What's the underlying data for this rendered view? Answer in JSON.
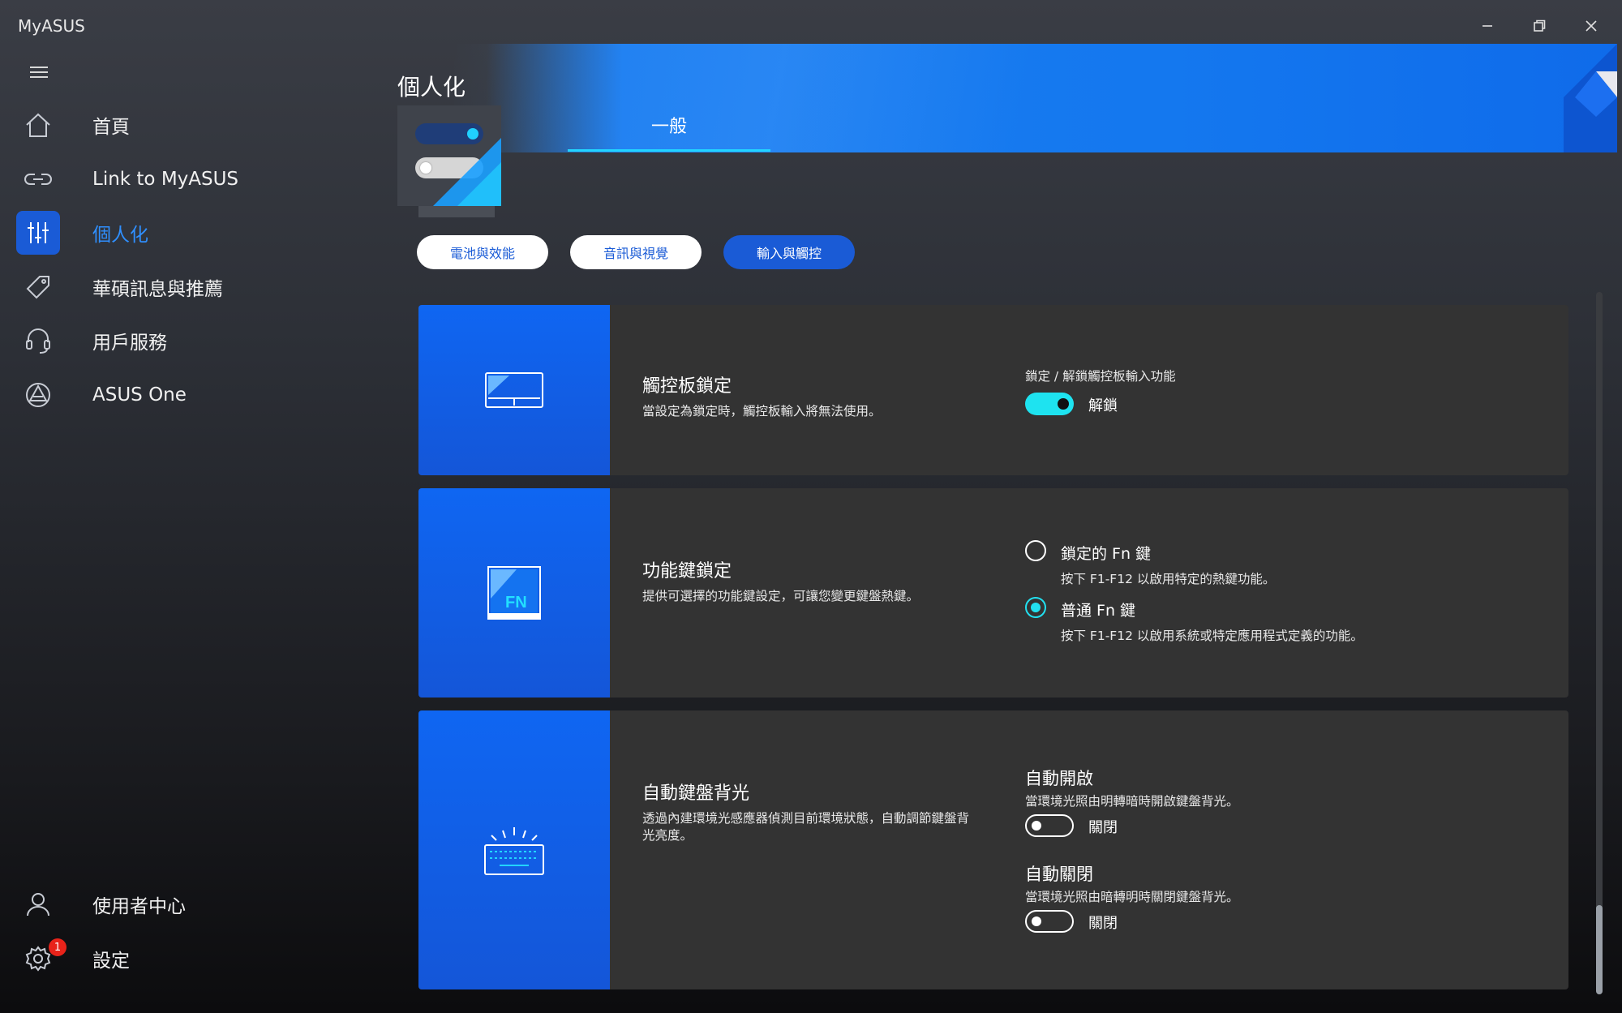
{
  "app": {
    "title": "MyASUS"
  },
  "window_controls": {
    "minimize": "minimize-icon",
    "restore": "restore-icon",
    "close": "close-icon"
  },
  "sidebar": {
    "items": [
      {
        "label": "首頁",
        "icon": "home-icon"
      },
      {
        "label": "Link to MyASUS",
        "icon": "link-icon"
      },
      {
        "label": "個人化",
        "icon": "sliders-icon",
        "active": true
      },
      {
        "label": "華碩訊息與推薦",
        "icon": "tag-icon"
      },
      {
        "label": "用戶服務",
        "icon": "headset-icon"
      },
      {
        "label": "ASUS One",
        "icon": "asus-one-icon"
      }
    ],
    "bottom": [
      {
        "label": "使用者中心",
        "icon": "user-icon"
      },
      {
        "label": "設定",
        "icon": "gear-icon",
        "badge": "1"
      }
    ]
  },
  "header": {
    "title": "個人化",
    "tabs": [
      {
        "label": "一般",
        "active": true
      }
    ]
  },
  "categories": [
    {
      "label": "電池與效能",
      "active": false
    },
    {
      "label": "音訊與視覺",
      "active": false
    },
    {
      "label": "輸入與觸控",
      "active": true
    }
  ],
  "cards": {
    "touchpad": {
      "icon": "touchpad-icon",
      "title": "觸控板鎖定",
      "description": "當設定為鎖定時，觸控板輸入將無法使用。",
      "option_label": "鎖定 / 解鎖觸控板輸入功能",
      "toggle_on": true,
      "toggle_text": "解鎖"
    },
    "fn_lock": {
      "icon": "fn-key-icon",
      "title": "功能鍵鎖定",
      "description": "提供可選擇的功能鍵設定，可讓您變更鍵盤熱鍵。",
      "options": [
        {
          "label": "鎖定的 Fn 鍵",
          "desc": "按下 F1-F12 以啟用特定的熱鍵功能。",
          "checked": false
        },
        {
          "label": "普通 Fn 鍵",
          "desc": "按下 F1-F12 以啟用系統或特定應用程式定義的功能。",
          "checked": true
        }
      ]
    },
    "backlight": {
      "icon": "keyboard-backlight-icon",
      "title": "自動鍵盤背光",
      "description_line1": "透過內建環境光感應器偵測目前環境狀態，自動調節鍵盤背",
      "description_line2": "光亮度。",
      "auto_on": {
        "title": "自動開啟",
        "desc": "當環境光照由明轉暗時開啟鍵盤背光。",
        "toggle_text": "關閉",
        "toggle_on": false
      },
      "auto_off": {
        "title": "自動關閉",
        "desc": "當環境光照由暗轉明時關閉鍵盤背光。",
        "toggle_text": "關閉",
        "toggle_on": false
      }
    }
  },
  "colors": {
    "accent": "#1a5bd6",
    "highlight": "#22e0f0",
    "card_bg": "#333333",
    "banner": "#1478ef"
  }
}
